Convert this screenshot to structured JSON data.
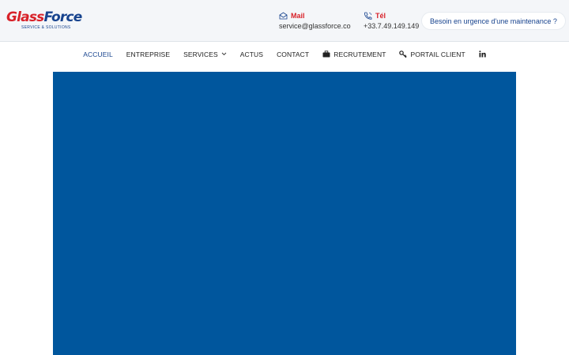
{
  "logo": {
    "part1": "Glass",
    "part2": "Force",
    "tagline": "SERVICE & SOLUTIONS"
  },
  "contact": {
    "mail_label": "Mail",
    "mail_value": "service@glassforce.co",
    "tel_label": "Tél",
    "tel_value": "+33.7.49.149.149"
  },
  "cta": {
    "urgent_label": "Besoin en urgence d'une maintenance ?"
  },
  "nav": {
    "accueil": "ACCUEIL",
    "entreprise": "ENTREPRISE",
    "services": "SERVICES",
    "actus": "ACTUS",
    "contact": "CONTACT",
    "recrutement": "RECRUTEMENT",
    "portail": "PORTAIL CLIENT"
  },
  "icons": {
    "mail": "mail-icon",
    "phone": "phone-icon",
    "chevron": "chevron-down-icon",
    "briefcase": "briefcase-icon",
    "key": "key-icon",
    "linkedin": "linkedin-icon"
  },
  "colors": {
    "brand_red": "#d8222a",
    "brand_blue": "#17438e",
    "hero_blue": "#00569d",
    "topbar_bg": "#f4f6f9"
  }
}
